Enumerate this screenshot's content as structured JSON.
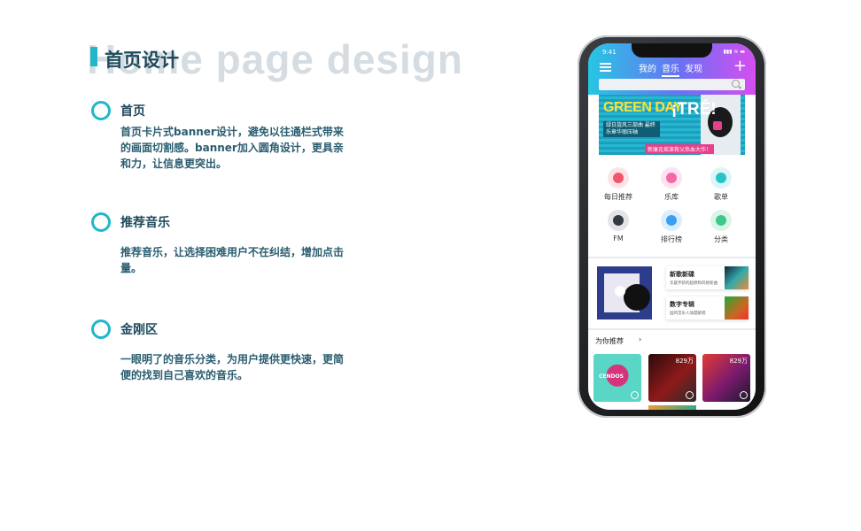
{
  "heading": {
    "bg_text": "Home page design",
    "title": "首页设计"
  },
  "sections": [
    {
      "title": "首页",
      "desc": "首页卡片式banner设计，避免以往通栏式带来的画面切割感。banner加入圆角设计，更具亲和力，让信息更突出。"
    },
    {
      "title": "推荐音乐",
      "desc": "推荐音乐，让选择困难用户不在纠结，增加点击量。"
    },
    {
      "title": "金刚区",
      "desc": "一眼明了的音乐分类，为用户提供更快速，更简便的找到自己喜欢的音乐。"
    }
  ],
  "phone": {
    "status_time": "9:41",
    "status_icons": "▮▮▮ ≋ ▬",
    "tabs": [
      "我的",
      "音乐",
      "发现"
    ],
    "active_tab": "音乐",
    "banner": {
      "title1": "GREEN DAY",
      "title2": "¡TRÉ!",
      "sub": "绿日旋风三部曲 最终乐章华丽压轴",
      "caption": "新康克摇滚救父热血大作！"
    },
    "quick_entries": [
      {
        "label": "每日推荐",
        "icon": "calendar-icon",
        "color": "#f2566a"
      },
      {
        "label": "乐库",
        "icon": "music-library-icon",
        "color": "#f468a8"
      },
      {
        "label": "歌单",
        "icon": "playlist-icon",
        "color": "#27c3c9"
      },
      {
        "label": "FM",
        "icon": "radio-icon",
        "color": "#333a44"
      },
      {
        "label": "排行榜",
        "icon": "chart-icon",
        "color": "#3a9ff2"
      },
      {
        "label": "分类",
        "icon": "category-icon",
        "color": "#3cc98a"
      }
    ],
    "new_releases": [
      {
        "title": "新歌新碟",
        "sub": "华晨宇新的超燃和风格新曲"
      },
      {
        "title": "数字专辑",
        "sub": "国风音乐人加盟献唱"
      }
    ],
    "recommend": {
      "heading": "为你推荐",
      "arrow": "›",
      "cards": [
        {
          "plays": "",
          "brand": "CENDOS",
          "color": "#59d6c6"
        },
        {
          "plays": "829万",
          "brand": "",
          "color": "#6a1212"
        },
        {
          "plays": "829万",
          "brand": "",
          "color": "#c9262e"
        }
      ]
    },
    "colors": {
      "accent": "#21b7c9",
      "header_gradient_start": "#27c6e3",
      "header_gradient_end": "#d64ef0"
    }
  }
}
